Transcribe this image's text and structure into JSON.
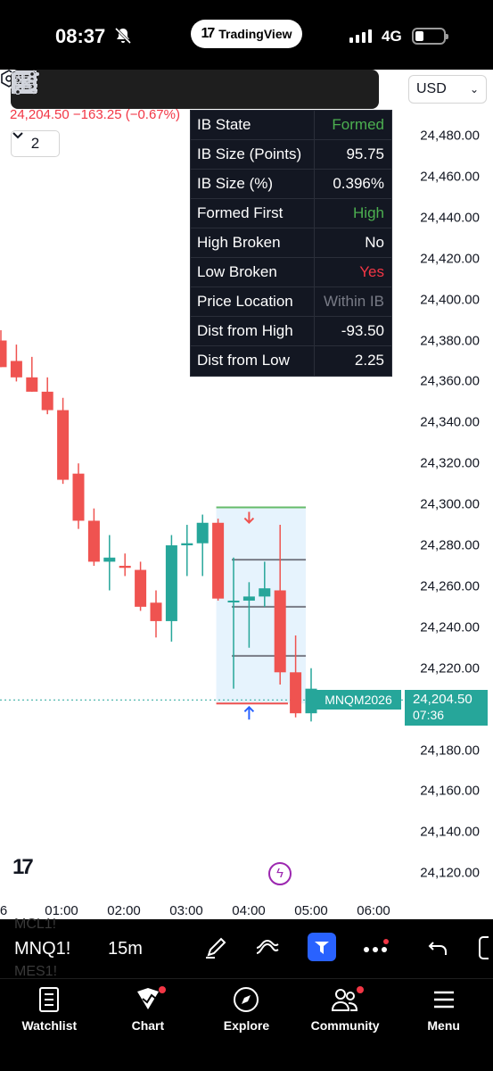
{
  "status": {
    "time": "08:37",
    "app_pill": "TradingView",
    "network": "4G"
  },
  "chart": {
    "price_header": "24,204.50 −163.25 (−0.67%)",
    "collapse_count": "2",
    "currency": "USD",
    "symbol_label": "MNQM2026",
    "last_price": "24,204.50",
    "countdown": "07:36",
    "y_ticks": [
      "24,480.00",
      "24,460.00",
      "24,440.00",
      "24,420.00",
      "24,400.00",
      "24,380.00",
      "24,360.00",
      "24,340.00",
      "24,320.00",
      "24,300.00",
      "24,280.00",
      "24,260.00",
      "24,240.00",
      "24,220.00",
      "24,200.00",
      "24,180.00",
      "24,160.00",
      "24,140.00",
      "24,120.00"
    ],
    "x_ticks": [
      "6",
      "01:00",
      "02:00",
      "03:00",
      "04:00",
      "05:00",
      "06:00"
    ]
  },
  "ib_table": [
    {
      "key": "IB State",
      "value": "Formed",
      "color": "#4caf50"
    },
    {
      "key": "IB Size (Points)",
      "value": "95.75",
      "color": "#ffffff"
    },
    {
      "key": "IB Size (%)",
      "value": "0.396%",
      "color": "#ffffff"
    },
    {
      "key": "Formed First",
      "value": "High",
      "color": "#4caf50"
    },
    {
      "key": "High Broken",
      "value": "No",
      "color": "#ffffff"
    },
    {
      "key": "Low Broken",
      "value": "Yes",
      "color": "#f23645"
    },
    {
      "key": "Price Location",
      "value": "Within IB",
      "color": "#787b86"
    },
    {
      "key": "Dist from High",
      "value": "-93.50",
      "color": "#ffffff"
    },
    {
      "key": "Dist from Low",
      "value": "2.25",
      "color": "#ffffff"
    }
  ],
  "chart_data": {
    "type": "candlestick",
    "ylim": [
      24110,
      24490
    ],
    "up_color": "#26a69a",
    "down_color": "#ef5350",
    "candles": [
      {
        "o": 24380,
        "h": 24385,
        "l": 24367,
        "c": 24367
      },
      {
        "o": 24370,
        "h": 24378,
        "l": 24360,
        "c": 24362
      },
      {
        "o": 24362,
        "h": 24372,
        "l": 24355,
        "c": 24355
      },
      {
        "o": 24355,
        "h": 24362,
        "l": 24344,
        "c": 24346
      },
      {
        "o": 24346,
        "h": 24352,
        "l": 24310,
        "c": 24312
      },
      {
        "o": 24315,
        "h": 24320,
        "l": 24288,
        "c": 24292
      },
      {
        "o": 24292,
        "h": 24298,
        "l": 24270,
        "c": 24272
      },
      {
        "o": 24272,
        "h": 24285,
        "l": 24258,
        "c": 24274
      },
      {
        "o": 24270,
        "h": 24276,
        "l": 24265,
        "c": 24269
      },
      {
        "o": 24268,
        "h": 24272,
        "l": 24248,
        "c": 24250
      },
      {
        "o": 24252,
        "h": 24258,
        "l": 24235,
        "c": 24243
      },
      {
        "o": 24243,
        "h": 24285,
        "l": 24233,
        "c": 24280
      },
      {
        "o": 24280,
        "h": 24290,
        "l": 24265,
        "c": 24281
      },
      {
        "o": 24281,
        "h": 24295,
        "l": 24265,
        "c": 24291
      },
      {
        "o": 24291,
        "h": 24293,
        "l": 24253,
        "c": 24254
      },
      {
        "o": 24253,
        "h": 24274,
        "l": 24210,
        "c": 24253
      },
      {
        "o": 24253,
        "h": 24262,
        "l": 24230,
        "c": 24255
      },
      {
        "o": 24255,
        "h": 24272,
        "l": 24250,
        "c": 24259
      },
      {
        "o": 24258,
        "h": 24290,
        "l": 24212,
        "c": 24218
      },
      {
        "o": 24218,
        "h": 24236,
        "l": 24196,
        "c": 24198
      },
      {
        "o": 24198,
        "h": 24220,
        "l": 24194,
        "c": 24210
      }
    ],
    "ib_high": 24298.5,
    "ib_low": 24202.75,
    "ib_levels": [
      24273,
      24250,
      24226
    ],
    "current_price": 24204.5
  },
  "symbar": {
    "symbol": "MNQ1!",
    "interval": "15m",
    "ghost_above": "MCL1!",
    "ghost_below": "MES1!"
  },
  "nav": [
    {
      "label": "Watchlist"
    },
    {
      "label": "Chart"
    },
    {
      "label": "Explore"
    },
    {
      "label": "Community"
    },
    {
      "label": "Menu"
    }
  ]
}
